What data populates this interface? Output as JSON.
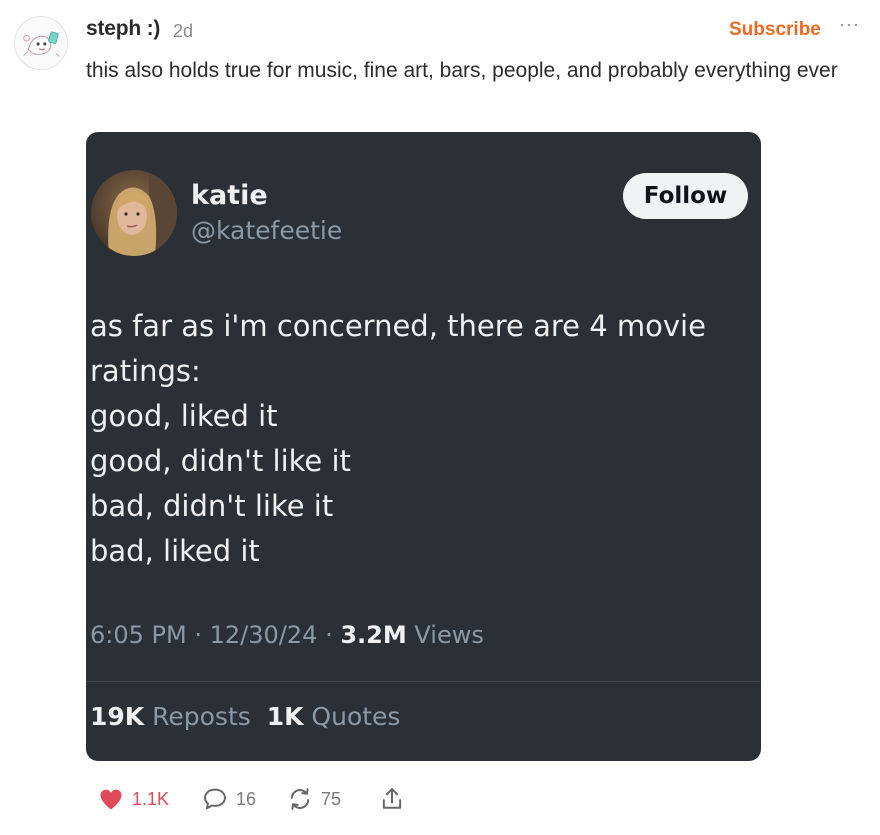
{
  "post": {
    "author": "steph :)",
    "time": "2d",
    "subscribe_label": "Subscribe",
    "more_label": "···",
    "text": "this also holds true for music, fine art, bars, people, and probably everything ever"
  },
  "tweet": {
    "name": "katie",
    "handle": "@katefeetie",
    "follow_label": "Follow",
    "lines": [
      "as far as i'm concerned, there are 4 movie",
      "ratings:",
      "good, liked it",
      "good, didn't like it",
      "bad, didn't like it",
      "bad, liked it"
    ],
    "time": "6:05 PM",
    "date": "12/30/24",
    "separator": "·",
    "views_count": "3.2M",
    "views_label": "Views",
    "reposts_count": "19K",
    "reposts_label": "Reposts",
    "quotes_count": "1K",
    "quotes_label": "Quotes"
  },
  "actions": {
    "likes": "1.1K",
    "comments": "16",
    "restacks": "75"
  },
  "colors": {
    "accent": "#ef6a21",
    "like": "#e04a59",
    "tweet_bg": "#2b3036"
  }
}
